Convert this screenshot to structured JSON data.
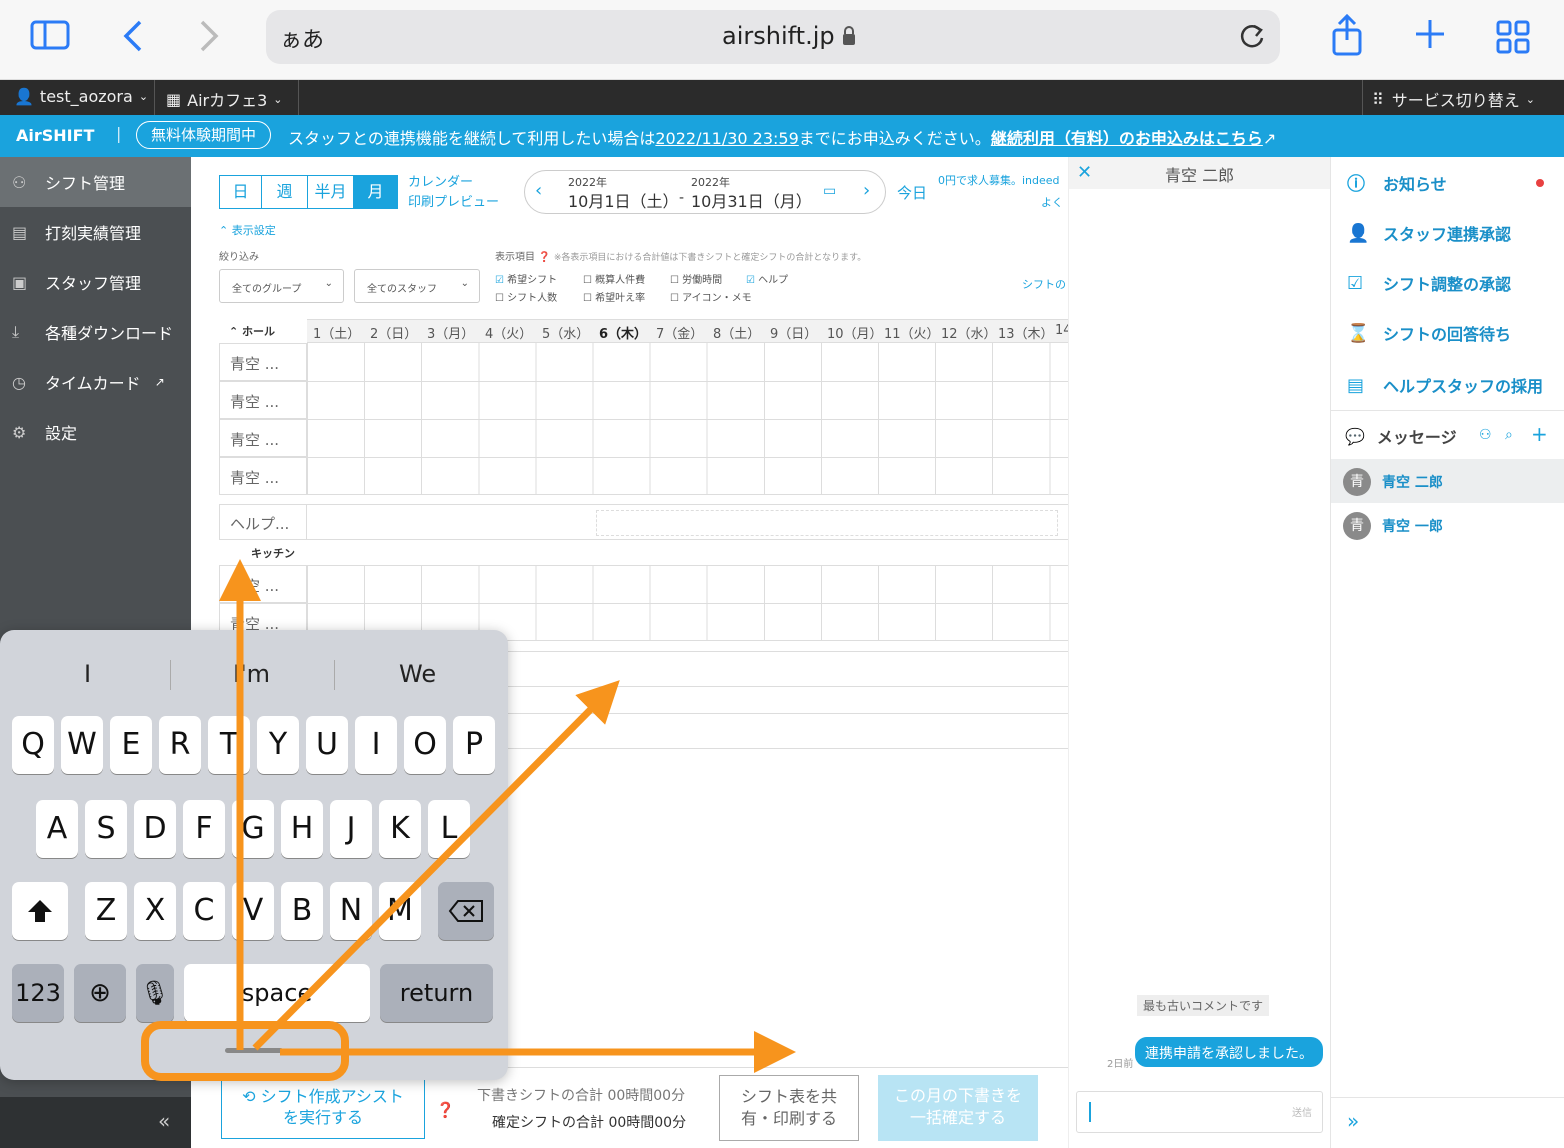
{
  "browser": {
    "ime": "ぁあ",
    "url": "airshift.jp"
  },
  "topbar": {
    "user": "test_aozora",
    "store": "Airカフェ3",
    "switch": "サービス切り替え"
  },
  "banner": {
    "logo": "AirSHIFT",
    "trial": "無料体験期間中",
    "message_pre": "スタッフとの連携機能を継続して利用したい場合は",
    "deadline": "2022/11/30 23:59",
    "message_post": "までにお申込みください。",
    "link": "継続利用（有料）のお申込みはこちら"
  },
  "sidebar": {
    "items": [
      {
        "label": "シフト管理"
      },
      {
        "label": "打刻実績管理"
      },
      {
        "label": "スタッフ管理"
      },
      {
        "label": "各種ダウンロード"
      },
      {
        "label": "タイムカード"
      },
      {
        "label": "設定"
      }
    ],
    "collapse": "«"
  },
  "toolbar": {
    "tabs": [
      "日",
      "週",
      "半月",
      "月"
    ],
    "calendar_preview_1": "カレンダー",
    "calendar_preview_2": "印刷プレビュー",
    "start_year": "2022年",
    "start_date": "10月1日（土）",
    "end_year": "2022年",
    "end_date": "10月31日（月）",
    "range_sep": "-",
    "today": "今日",
    "promo": "0円で求人募集。indeed",
    "promo2": "よく"
  },
  "display": {
    "toggle": "表示設定",
    "filter_label": "絞り込み",
    "group_select": "全てのグループ",
    "staff_select": "全てのスタッフ",
    "items_label": "表示項目",
    "note": "※各表示項目における合計値は下書きシフトと確定シフトの合計となります。",
    "checks": [
      {
        "label": "希望シフト",
        "checked": true
      },
      {
        "label": "概算人件費",
        "checked": false
      },
      {
        "label": "労働時間",
        "checked": false
      },
      {
        "label": "ヘルプ",
        "checked": true
      },
      {
        "label": "シフト人数",
        "checked": false
      },
      {
        "label": "希望叶え率",
        "checked": false
      },
      {
        "label": "アイコン・メモ",
        "checked": false
      }
    ],
    "shift_link": "シフトの"
  },
  "grid": {
    "hall": "ホール",
    "kitchen": "キッチン",
    "days": [
      "1（土）",
      "2（日）",
      "3（月）",
      "4（火）",
      "5（水）",
      "6（木）",
      "7（金）",
      "8（土）",
      "9（日）",
      "10（月）",
      "11（火）",
      "12（水）",
      "13（木）",
      "14"
    ],
    "hall_rows": [
      "青空 ...",
      "青空 ...",
      "青空 ...",
      "青空 ..."
    ],
    "help_row": "ヘルプ...",
    "kitchen_rows": [
      "青空 ...",
      "青空 ..."
    ]
  },
  "footer": {
    "assist_1": "シフト作成アシスト",
    "assist_2": "を実行する",
    "draft_total": "下書きシフトの合計 00時間00分",
    "confirmed_total": "確定シフトの合計 00時間00分",
    "share_1": "シフト表を共",
    "share_2": "有・印刷する",
    "confirm_1": "この月の下書きを",
    "confirm_2": "一括確定する"
  },
  "chat": {
    "title": "青空 二郎",
    "oldest": "最も古いコメントです",
    "bubble": "連携申請を承認しました。",
    "time": "2日前",
    "send": "送信"
  },
  "rpanel": {
    "items": [
      {
        "label": "お知らせ"
      },
      {
        "label": "スタッフ連携承認"
      },
      {
        "label": "シフト調整の承認"
      },
      {
        "label": "シフトの回答待ち"
      },
      {
        "label": "ヘルプスタッフの採用"
      }
    ],
    "messages": "メッセージ",
    "contacts": [
      {
        "avatar": "青",
        "name": "青空 二郎"
      },
      {
        "avatar": "青",
        "name": "青空 一郎"
      }
    ],
    "expand": "»"
  },
  "keyboard": {
    "suggestions": [
      "I",
      "I'm",
      "We"
    ],
    "row1": [
      "Q",
      "W",
      "E",
      "R",
      "T",
      "Y",
      "U",
      "I",
      "O",
      "P"
    ],
    "row2": [
      "A",
      "S",
      "D",
      "F",
      "G",
      "H",
      "J",
      "K",
      "L"
    ],
    "row3": [
      "Z",
      "X",
      "C",
      "V",
      "B",
      "N",
      "M"
    ],
    "num": "123",
    "space": "space",
    "return": "return"
  },
  "colors": {
    "accent": "#1aa3dd",
    "annotation": "#f7941d",
    "sidebar": "#4b4f52"
  }
}
